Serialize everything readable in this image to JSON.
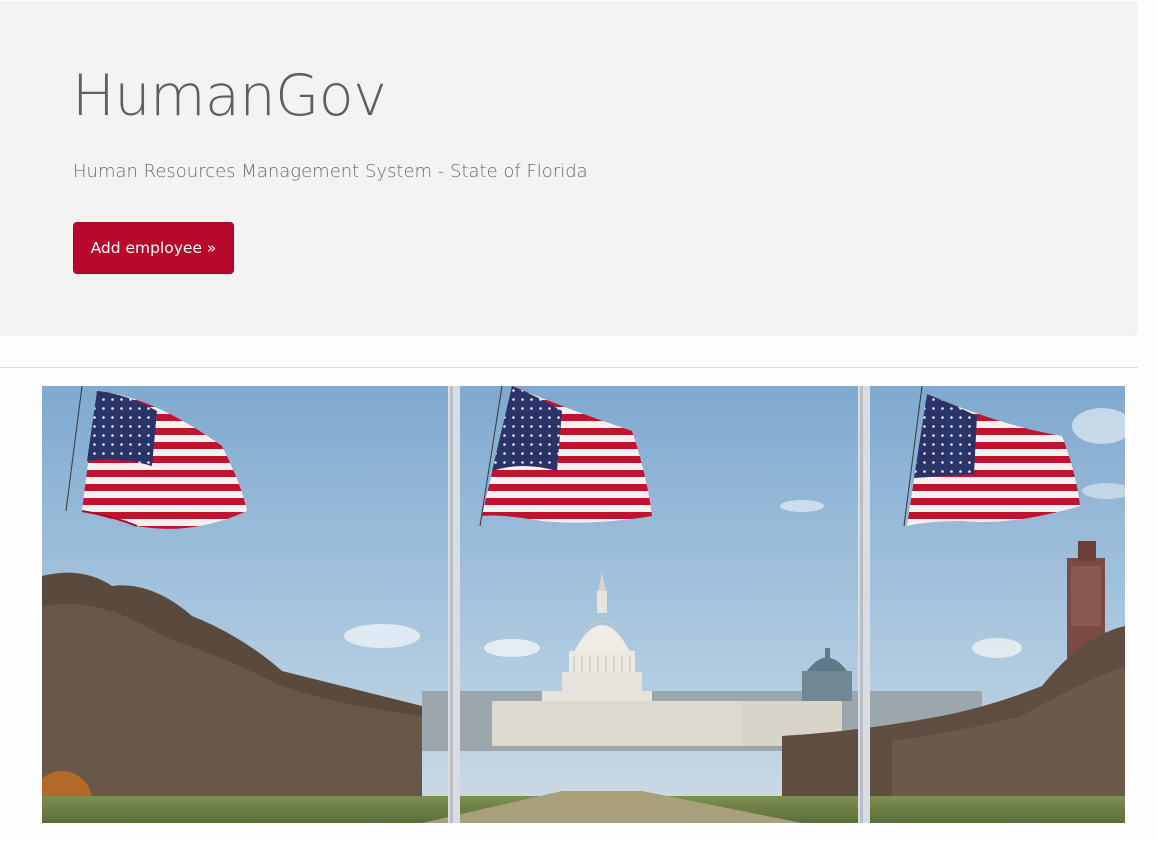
{
  "header": {
    "title": "HumanGov",
    "subtitle": "Human Resources Management System - State of Florida",
    "add_button_label": "Add employee »"
  },
  "colors": {
    "button_bg": "#b8092c",
    "jumbotron_bg": "#f3f3f3",
    "title_text": "#5f5f5f"
  },
  "hero_image": {
    "icon": "us-capitol-flags-photo"
  }
}
